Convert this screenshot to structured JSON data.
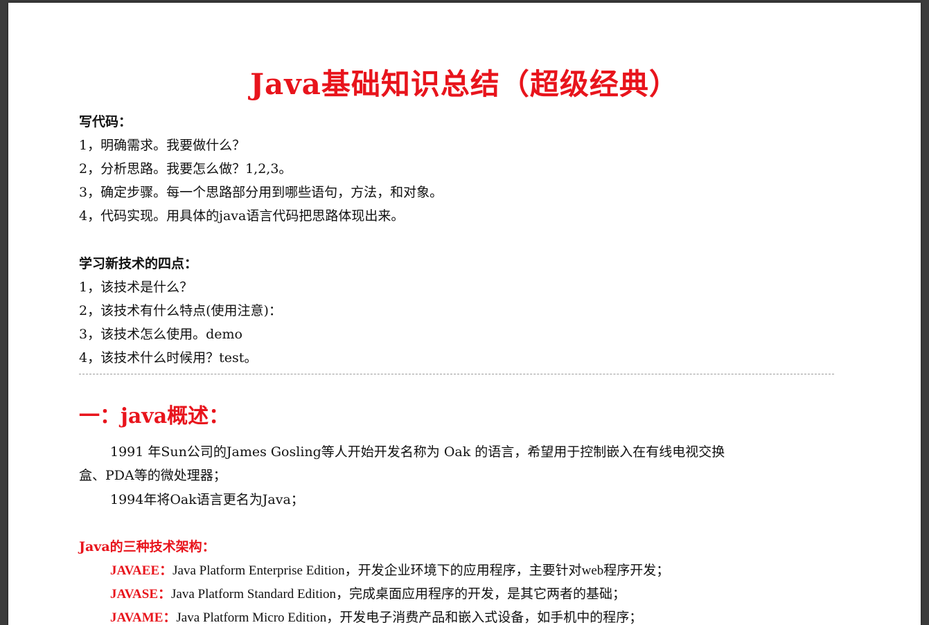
{
  "document": {
    "title": "Java基础知识总结（超级经典）",
    "write_code": {
      "heading": "写代码：",
      "items": [
        "1，明确需求。我要做什么？",
        "2，分析思路。我要怎么做？1,2,3。",
        "3，确定步骤。每一个思路部分用到哪些语句，方法，和对象。",
        "4，代码实现。用具体的java语言代码把思路体现出来。"
      ]
    },
    "learn_tech": {
      "heading": "学习新技术的四点：",
      "items": [
        "1，该技术是什么？",
        "2，该技术有什么特点(使用注意)：",
        "3，该技术怎么使用。demo",
        "4，该技术什么时候用？test。"
      ]
    },
    "overview": {
      "heading": "一：java概述：",
      "p1_line1": "1991 年Sun公司的James Gosling等人开始开发名称为 Oak 的语言，希望用于控制嵌入在有线电视交换",
      "p1_line2": "盒、PDA等的微处理器；",
      "p2": "1994年将Oak语言更名为Java；"
    },
    "architectures": {
      "heading": "Java的三种技术架构：",
      "items": [
        {
          "label": "JAVAEE：",
          "text": "Java Platform Enterprise Edition，开发企业环境下的应用程序，主要针对web程序开发；"
        },
        {
          "label": "JAVASE：",
          "text": "Java Platform Standard Edition，完成桌面应用程序的开发，是其它两者的基础；"
        },
        {
          "label": "JAVAME：",
          "text": "Java Platform Micro Edition，开发电子消费产品和嵌入式设备，如手机中的程序；"
        }
      ]
    }
  }
}
